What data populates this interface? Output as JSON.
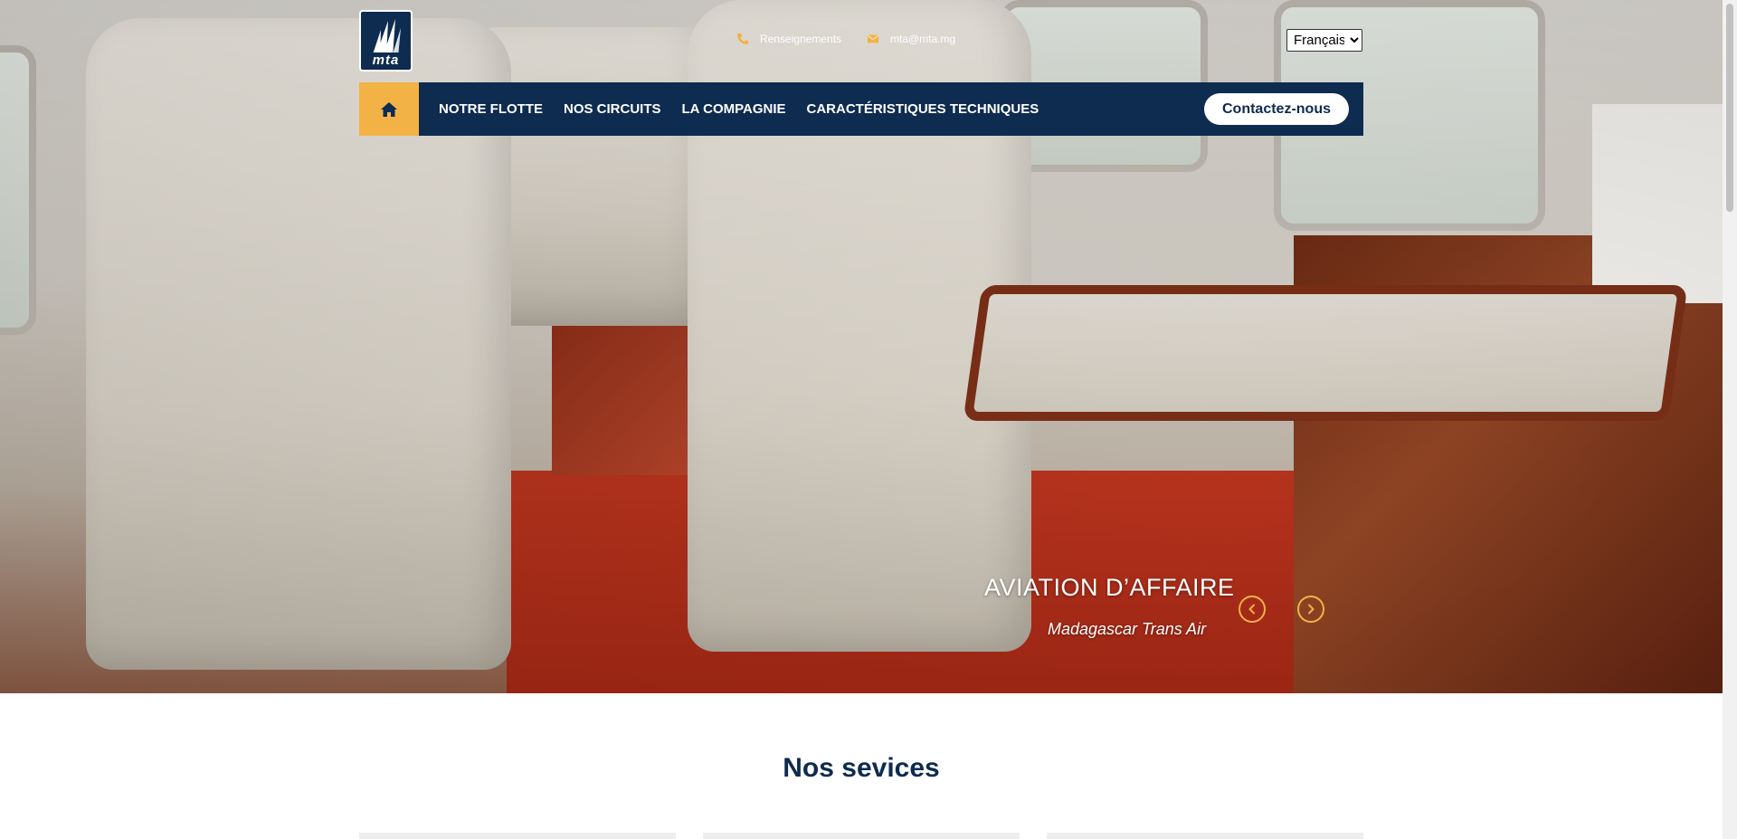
{
  "brand": {
    "logo_text": "mta"
  },
  "topbar": {
    "phone_label": "Renseignements",
    "email_label": "mta@mta.mg",
    "language": {
      "selected": "Français",
      "options": [
        "Français"
      ]
    }
  },
  "nav": {
    "home_icon": "home-icon",
    "items": [
      {
        "label": "NOTRE FLOTTE"
      },
      {
        "label": "NOS CIRCUITS"
      },
      {
        "label": "LA COMPAGNIE"
      },
      {
        "label": "CARACTÉRISTIQUES TECHNIQUES"
      }
    ],
    "contact_label": "Contactez-nous"
  },
  "slider": {
    "title": "AVIATION D’AFFAIRE",
    "subtitle": "Madagascar Trans Air"
  },
  "services": {
    "title": "Nos sevices",
    "card_count": 3
  },
  "colors": {
    "navy": "#0e2b50",
    "accent": "#f3b246"
  }
}
